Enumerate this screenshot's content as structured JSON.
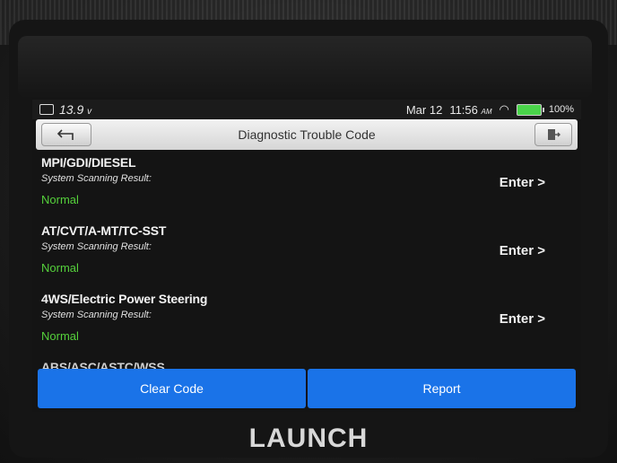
{
  "statusbar": {
    "voltage": "13.9",
    "voltage_unit": "v",
    "date": "Mar 12",
    "time": "11:56",
    "ampm": "AM",
    "battery_pct": "100%"
  },
  "titlebar": {
    "title": "Diagnostic Trouble Code",
    "back_icon": "back-arrow-icon",
    "exit_icon": "exit-icon"
  },
  "systems": [
    {
      "name": "MPI/GDI/DIESEL",
      "sub": "System Scanning Result:",
      "status": "Normal",
      "action": "Enter >"
    },
    {
      "name": "AT/CVT/A-MT/TC-SST",
      "sub": "System Scanning Result:",
      "status": "Normal",
      "action": "Enter >"
    },
    {
      "name": "4WS/Electric Power Steering",
      "sub": "System Scanning Result:",
      "status": "Normal",
      "action": "Enter >"
    },
    {
      "name": "ABS/ASC/ASTC/WSS"
    }
  ],
  "buttons": {
    "clear_code": "Clear Code",
    "report": "Report"
  },
  "device": {
    "brand": "LAUNCH"
  },
  "colors": {
    "normal_status": "#55d03b",
    "button_blue": "#1a73e8"
  }
}
